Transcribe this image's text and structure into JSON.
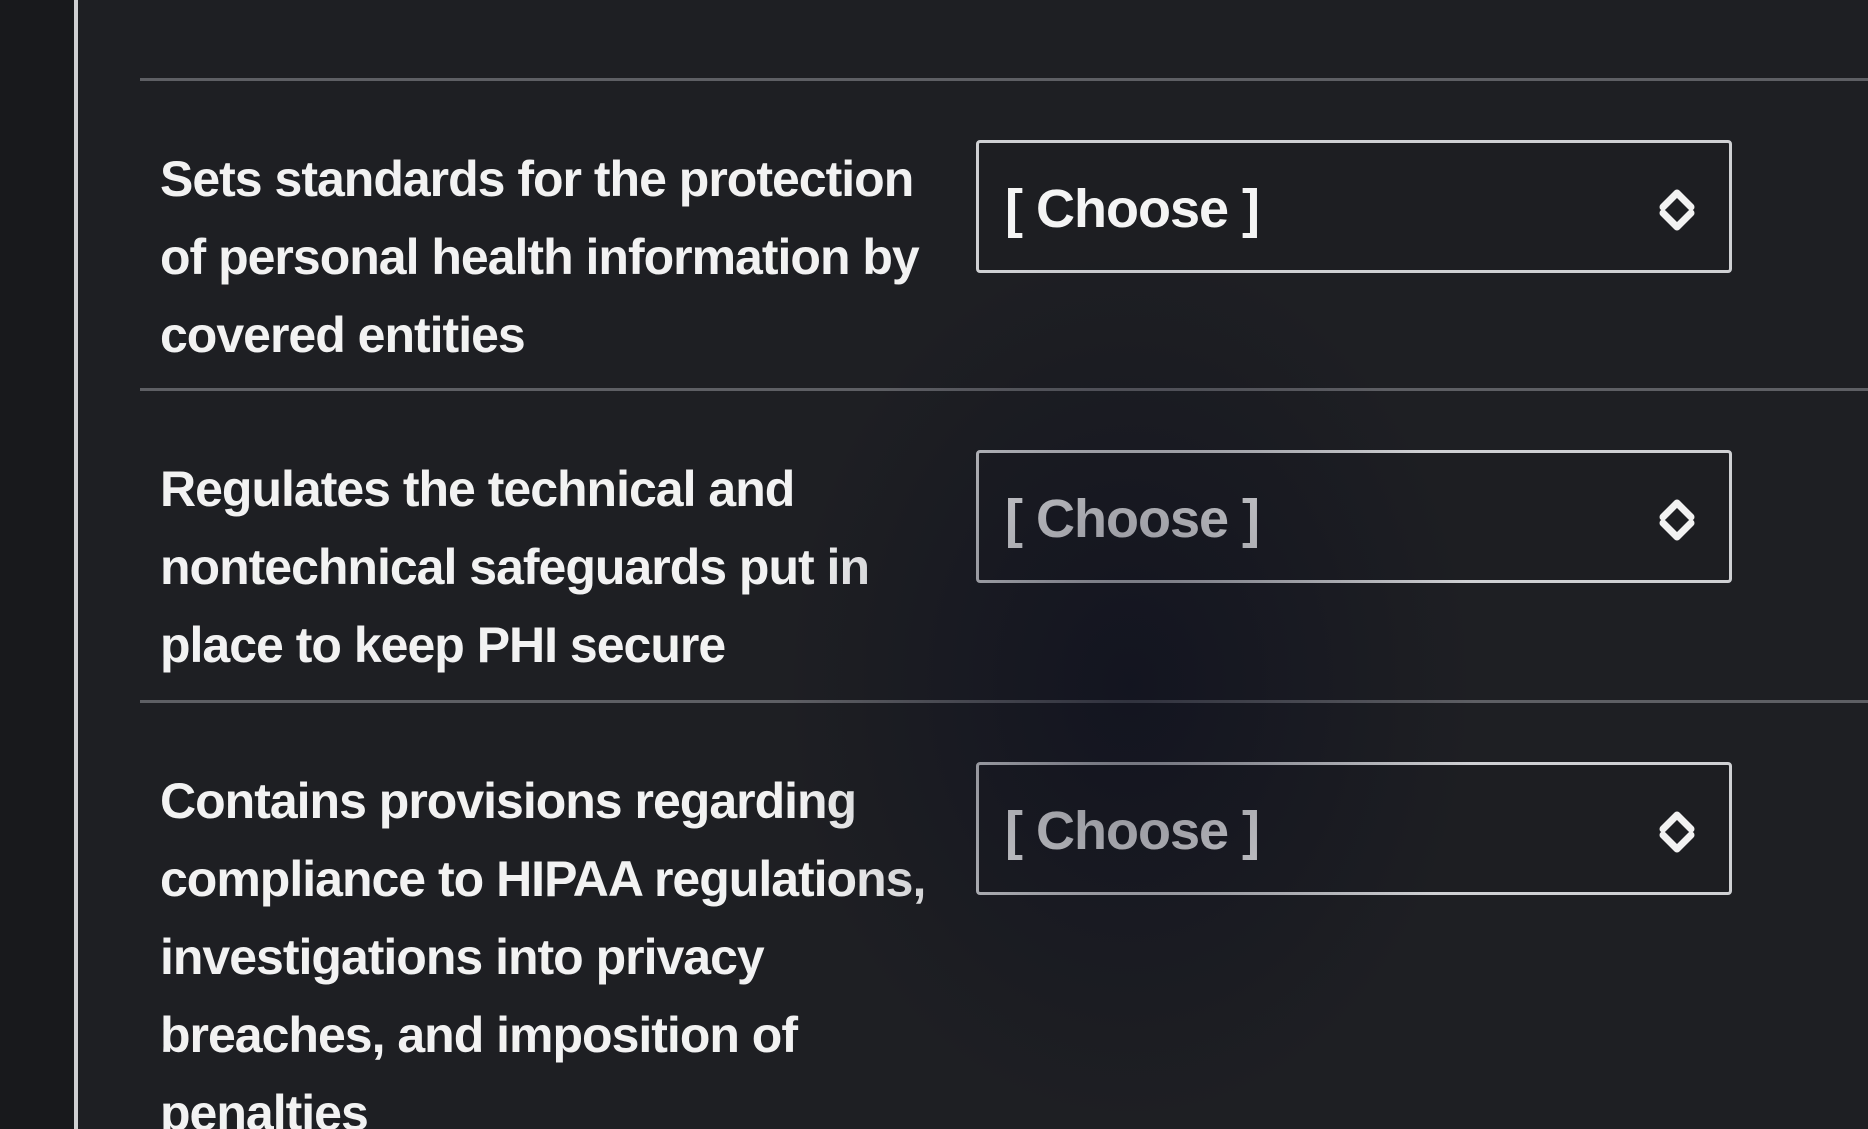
{
  "questions": [
    {
      "prompt": "Sets standards for the protection of personal health information by covered entities",
      "select_value": "[ Choose ]"
    },
    {
      "prompt": "Regulates the technical and nontechnical safeguards put in place to keep PHI secure",
      "select_value": "[ Choose ]"
    },
    {
      "prompt": "Contains provisions regarding compliance to HIPAA regulations, investigations into privacy breaches, and imposition of penalties",
      "select_value": "[ Choose ]"
    }
  ],
  "icons": {
    "select_arrow": "up-down-chevron-icon"
  },
  "colors": {
    "background": "#1e1f23",
    "text": "#f2f2f2",
    "border": "#cfd0d3"
  }
}
